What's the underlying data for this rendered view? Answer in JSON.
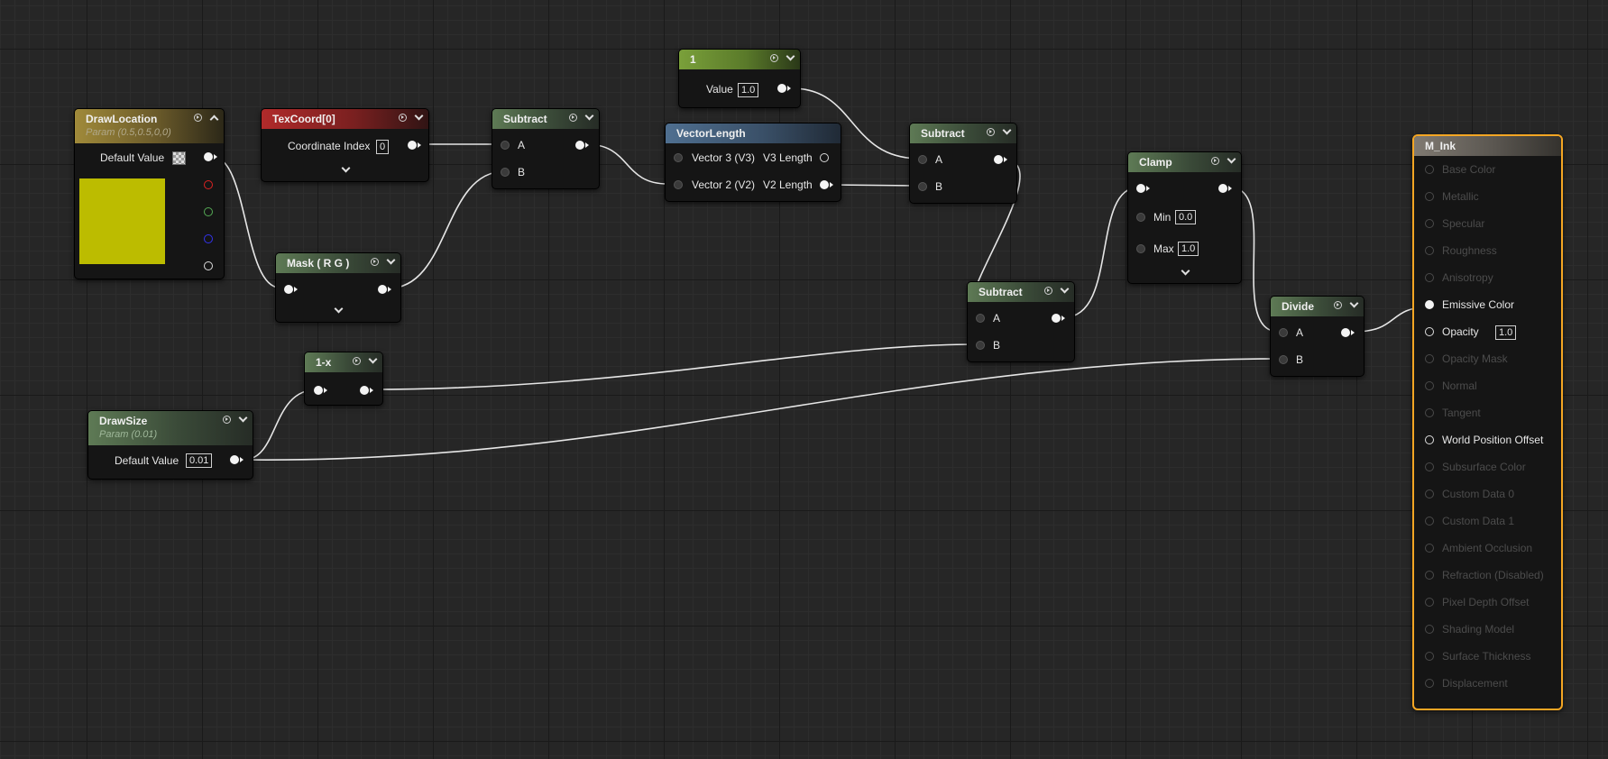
{
  "material": {
    "name": "M_Ink"
  },
  "nodes": {
    "draw_location": {
      "title": "DrawLocation",
      "subtitle": "Param (0.5,0.5,0,0)",
      "default_label": "Default Value",
      "swatch_color": "#bcbc00"
    },
    "texcoord": {
      "title": "TexCoord[0]",
      "coord_label": "Coordinate Index",
      "coord_value": "0"
    },
    "subtract_1": {
      "title": "Subtract",
      "pin_a": "A",
      "pin_b": "B"
    },
    "constant_1": {
      "title": "1",
      "value_label": "Value",
      "value": "1.0"
    },
    "vector_length": {
      "title": "VectorLength",
      "in_v3": "Vector 3 (V3)",
      "in_v2": "Vector 2 (V2)",
      "out_v3": "V3 Length",
      "out_v2": "V2 Length"
    },
    "subtract_2": {
      "title": "Subtract",
      "pin_a": "A",
      "pin_b": "B"
    },
    "mask": {
      "title": "Mask ( R G )"
    },
    "subtract_3": {
      "title": "Subtract",
      "pin_a": "A",
      "pin_b": "B"
    },
    "clamp": {
      "title": "Clamp",
      "min_label": "Min",
      "min_value": "0.0",
      "max_label": "Max",
      "max_value": "1.0"
    },
    "divide": {
      "title": "Divide",
      "pin_a": "A",
      "pin_b": "B"
    },
    "one_minus": {
      "title": "1-x"
    },
    "draw_size": {
      "title": "DrawSize",
      "subtitle": "Param (0.01)",
      "default_label": "Default Value",
      "default_value": "0.01"
    }
  },
  "output_inputs": [
    {
      "label": "Base Color",
      "connected": false
    },
    {
      "label": "Metallic",
      "connected": false
    },
    {
      "label": "Specular",
      "connected": false
    },
    {
      "label": "Roughness",
      "connected": false
    },
    {
      "label": "Anisotropy",
      "connected": false
    },
    {
      "label": "Emissive Color",
      "connected": true
    },
    {
      "label": "Opacity",
      "connected": false,
      "enabled": true,
      "value": "1.0"
    },
    {
      "label": "Opacity Mask",
      "connected": false
    },
    {
      "label": "Normal",
      "connected": false
    },
    {
      "label": "Tangent",
      "connected": false
    },
    {
      "label": "World Position Offset",
      "connected": false,
      "enabled": true
    },
    {
      "label": "Subsurface Color",
      "connected": false
    },
    {
      "label": "Custom Data 0",
      "connected": false
    },
    {
      "label": "Custom Data 1",
      "connected": false
    },
    {
      "label": "Ambient Occlusion",
      "connected": false
    },
    {
      "label": "Refraction (Disabled)",
      "connected": false
    },
    {
      "label": "Pixel Depth Offset",
      "connected": false
    },
    {
      "label": "Shading Model",
      "connected": false
    },
    {
      "label": "Surface Thickness",
      "connected": false
    },
    {
      "label": "Displacement",
      "connected": false
    }
  ],
  "colors": {
    "background": "#262626",
    "wire": "#e6e6e6",
    "output_border": "#f5a623"
  }
}
